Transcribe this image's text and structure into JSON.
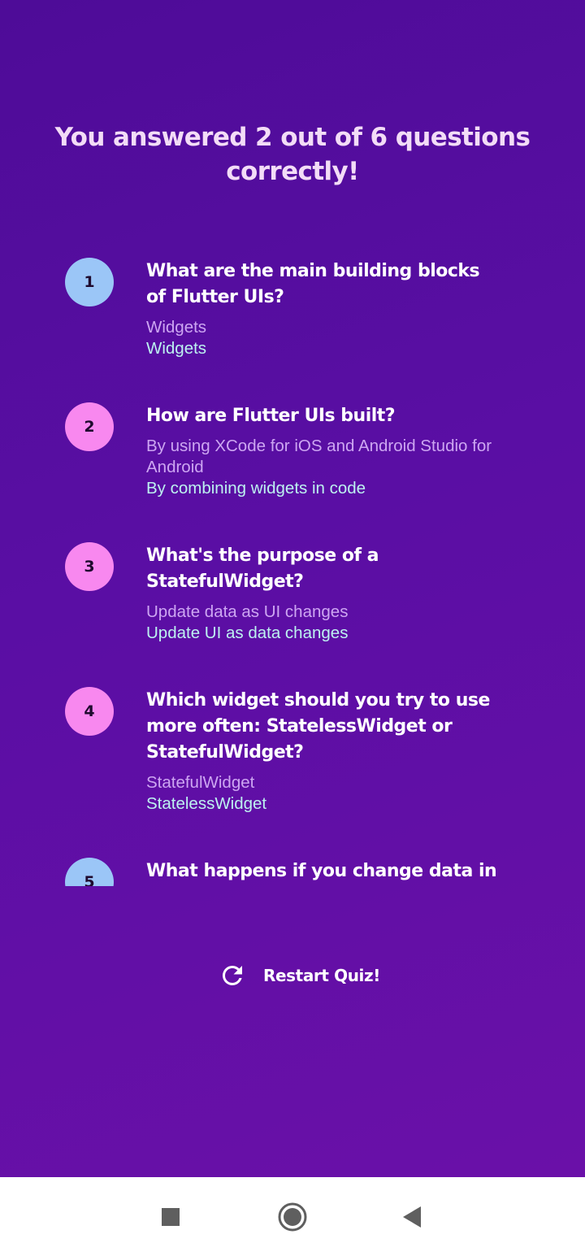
{
  "result": {
    "title": "You answered 2 out of 6 questions correctly!"
  },
  "summary": [
    {
      "index": "1",
      "question": "What are the main building blocks of Flutter UIs?",
      "user_answer": "Widgets",
      "correct_answer": "Widgets",
      "badge_color": "#9bc6f7"
    },
    {
      "index": "2",
      "question": "How are Flutter UIs built?",
      "user_answer": "By using XCode for iOS and Android Studio for Android",
      "correct_answer": "By combining widgets in code",
      "badge_color": "#f888ef"
    },
    {
      "index": "3",
      "question": "What's the purpose of a StatefulWidget?",
      "user_answer": "Update data as UI changes",
      "correct_answer": "Update UI as data changes",
      "badge_color": "#f888ef"
    },
    {
      "index": "4",
      "question": "Which widget should you try to use more often: StatelessWidget or StatefulWidget?",
      "user_answer": "StatefulWidget",
      "correct_answer": "StatelessWidget",
      "badge_color": "#f888ef"
    },
    {
      "index": "5",
      "question": "What happens if you change data in a",
      "badge_color": "#9bc6f7"
    }
  ],
  "restart": {
    "label": "Restart Quiz!",
    "icon": "refresh-icon"
  },
  "nav": {
    "recents_icon": "square-recents-icon",
    "home_icon": "circle-home-icon",
    "back_icon": "triangle-back-icon"
  },
  "colors": {
    "background_start": "#4e0c98",
    "background_end": "#6a10a8",
    "correct_badge": "#9bc6f7",
    "wrong_badge": "#f888ef",
    "user_answer_text": "#cda6f2",
    "correct_answer_text": "#bdf2f0",
    "title_text": "#f3dcf7"
  }
}
